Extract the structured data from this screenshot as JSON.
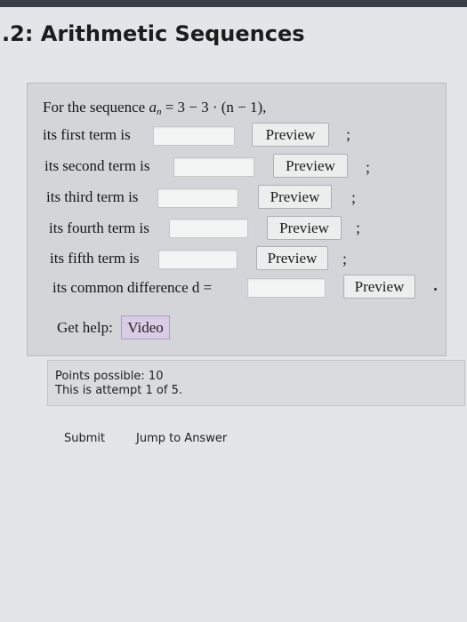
{
  "page": {
    "title": ".2: Arithmetic Sequences"
  },
  "question": {
    "intro": "For the sequence",
    "formula_var": "a",
    "formula_sub": "n",
    "formula_rest": " = 3 − 3 · (n − 1),",
    "rows": [
      {
        "label": "its first term is",
        "value": "",
        "preview": "Preview",
        "sep": ";"
      },
      {
        "label": "its second term is",
        "value": "",
        "preview": "Preview",
        "sep": ";"
      },
      {
        "label": "its third term is",
        "value": "",
        "preview": "Preview",
        "sep": ";"
      },
      {
        "label": "its fourth term is",
        "value": "",
        "preview": "Preview",
        "sep": ";"
      },
      {
        "label": "its fifth term is",
        "value": "",
        "preview": "Preview",
        "sep": ";"
      }
    ],
    "difference": {
      "label": "its common difference d =",
      "value": "",
      "preview": "Preview"
    },
    "help": {
      "label": "Get help:",
      "video_label": "Video"
    }
  },
  "status": {
    "points": "Points possible: 10",
    "attempt": "This is attempt 1 of 5."
  },
  "actions": {
    "submit_label": "Submit",
    "jump_label": "Jump to Answer"
  },
  "colors": {
    "panel": "#d3d5d8",
    "video_button": "#d8cce6",
    "background": "#e4e5e8"
  }
}
